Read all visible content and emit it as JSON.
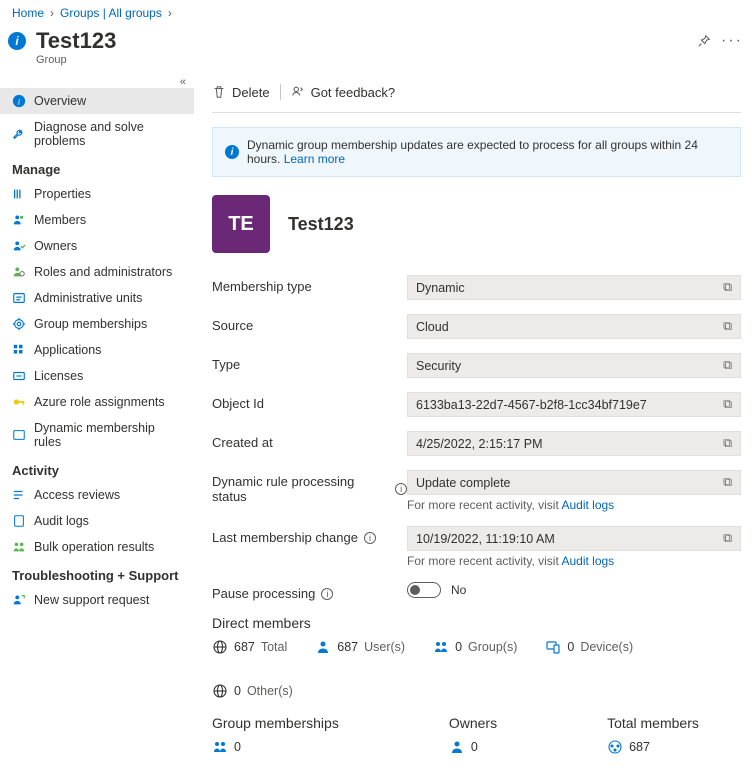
{
  "breadcrumb": {
    "home": "Home",
    "groups": "Groups | All groups"
  },
  "header": {
    "title": "Test123",
    "subtitle": "Group"
  },
  "sidebar": {
    "overview": "Overview",
    "diagnose": "Diagnose and solve problems",
    "manage_label": "Manage",
    "properties": "Properties",
    "members": "Members",
    "owners": "Owners",
    "roles": "Roles and administrators",
    "admin_units": "Administrative units",
    "group_memberships": "Group memberships",
    "applications": "Applications",
    "licenses": "Licenses",
    "azure_roles": "Azure role assignments",
    "dynamic_rules": "Dynamic membership rules",
    "activity_label": "Activity",
    "access_reviews": "Access reviews",
    "audit_logs": "Audit logs",
    "bulk_results": "Bulk operation results",
    "troubleshoot_label": "Troubleshooting + Support",
    "new_request": "New support request"
  },
  "toolbar": {
    "delete": "Delete",
    "feedback": "Got feedback?"
  },
  "banner": {
    "text": "Dynamic group membership updates are expected to process for all groups within 24 hours.",
    "link": "Learn more"
  },
  "entity": {
    "initials": "TE",
    "name": "Test123"
  },
  "details": {
    "membership_type": {
      "label": "Membership type",
      "value": "Dynamic"
    },
    "source": {
      "label": "Source",
      "value": "Cloud"
    },
    "type": {
      "label": "Type",
      "value": "Security"
    },
    "object_id": {
      "label": "Object Id",
      "value": "6133ba13-22d7-4567-b2f8-1cc34bf719e7"
    },
    "created_at": {
      "label": "Created at",
      "value": "4/25/2022, 2:15:17 PM"
    },
    "rule_status": {
      "label": "Dynamic rule processing status",
      "value": "Update complete",
      "hint_prefix": "For more recent activity, visit ",
      "hint_link": "Audit logs"
    },
    "last_change": {
      "label": "Last membership change",
      "value": "10/19/2022, 11:19:10 AM",
      "hint_prefix": "For more recent activity, visit ",
      "hint_link": "Audit logs"
    },
    "pause": {
      "label": "Pause processing",
      "value": "No"
    }
  },
  "stats": {
    "direct_members_title": "Direct members",
    "total": {
      "count": "687",
      "label": "Total"
    },
    "users": {
      "count": "687",
      "label": "User(s)"
    },
    "groups": {
      "count": "0",
      "label": "Group(s)"
    },
    "devices": {
      "count": "0",
      "label": "Device(s)"
    },
    "others": {
      "count": "0",
      "label": "Other(s)"
    },
    "group_memberships_title": "Group memberships",
    "group_memberships_count": "0",
    "owners_title": "Owners",
    "owners_count": "0",
    "total_members_title": "Total members",
    "total_members_count": "687"
  }
}
